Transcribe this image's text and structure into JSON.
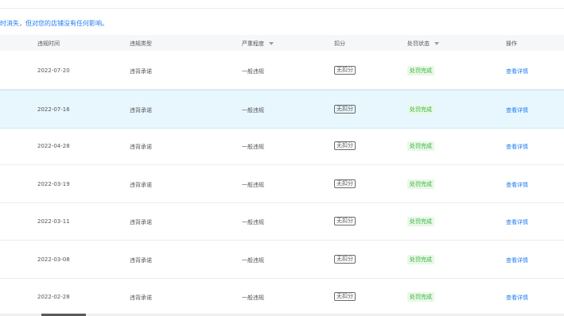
{
  "notice": "时消失，但对您的店铺没有任何影响。",
  "table": {
    "headers": [
      "违规时间",
      "违规类型",
      "严重程度",
      "扣分",
      "处罚状态",
      "操作"
    ],
    "rows": [
      {
        "date": "2022-07-20",
        "type": "违背承诺",
        "severity": "一般违规",
        "deduct": "无扣分",
        "status": "处罚完成",
        "action": "查看详情",
        "highlighted": false
      },
      {
        "date": "2022-07-16",
        "type": "违背承诺",
        "severity": "一般违规",
        "deduct": "无扣分",
        "status": "处罚完成",
        "action": "查看详情",
        "highlighted": true
      },
      {
        "date": "2022-04-28",
        "type": "违背承诺",
        "severity": "一般违规",
        "deduct": "无扣分",
        "status": "处罚完成",
        "action": "查看详情",
        "highlighted": false
      },
      {
        "date": "2022-03-19",
        "type": "违背承诺",
        "severity": "一般违规",
        "deduct": "无扣分",
        "status": "处罚完成",
        "action": "查看详情",
        "highlighted": false
      },
      {
        "date": "2022-03-11",
        "type": "违背承诺",
        "severity": "一般违规",
        "deduct": "无扣分",
        "status": "处罚完成",
        "action": "查看详情",
        "highlighted": false
      },
      {
        "date": "2022-03-08",
        "type": "违背承诺",
        "severity": "一般违规",
        "deduct": "无扣分",
        "status": "处罚完成",
        "action": "查看详情",
        "highlighted": false
      },
      {
        "date": "2022-02-28",
        "type": "违背承诺",
        "severity": "一般违规",
        "deduct": "无扣分",
        "status": "处罚完成",
        "action": "查看详情",
        "highlighted": false
      }
    ]
  },
  "colors": {
    "link": "#1f7cf0",
    "status_bg": "#e7f8e5",
    "status_text": "#3cb346",
    "highlight_row": "#e8f6fd"
  }
}
